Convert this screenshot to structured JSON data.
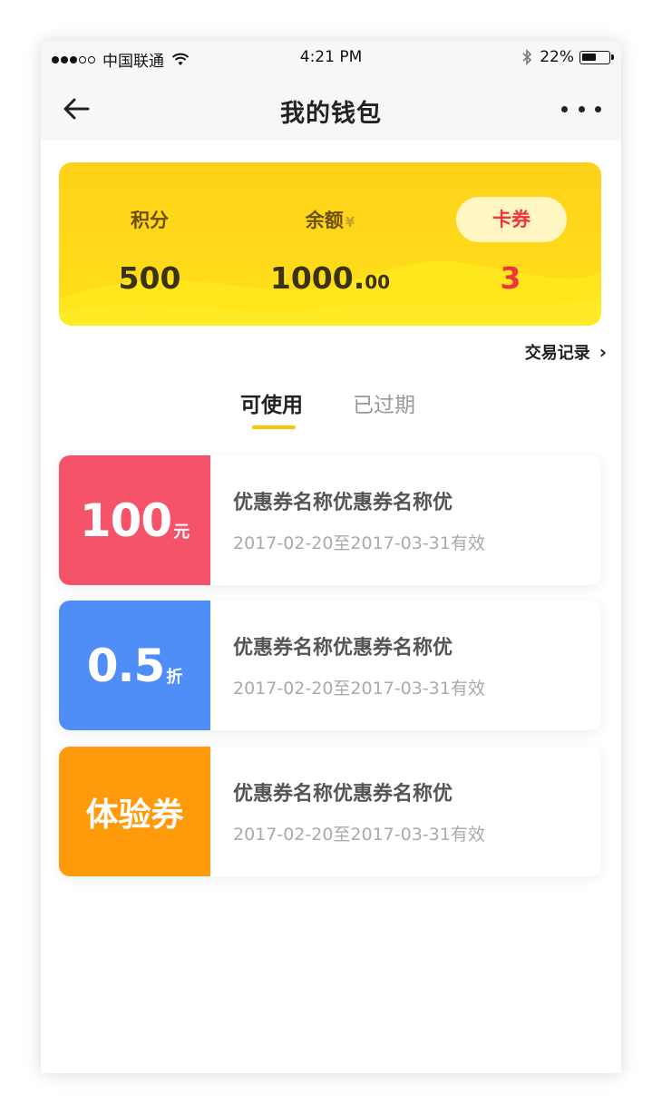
{
  "status_bar": {
    "carrier": "中国联通",
    "time": "4:21 PM",
    "battery_percent": "22%",
    "battery_level": 0.22,
    "icons": [
      "signal-dots-icon",
      "wifi-icon",
      "bluetooth-icon",
      "battery-icon"
    ]
  },
  "nav": {
    "title": "我的钱包",
    "back_icon": "arrow-left-icon",
    "more_icon": "more-dots-icon"
  },
  "wallet": {
    "points_label": "积分",
    "points_value": "500",
    "balance_label": "余额",
    "balance_currency": "¥",
    "balance_int": "1000.",
    "balance_dec": "00",
    "coupons_label": "卡券",
    "coupons_value": "3",
    "colors": {
      "card": "#ffd71a",
      "accent_red": "#f0343c"
    }
  },
  "transactions_link": "交易记录",
  "tabs": [
    {
      "label": "可使用",
      "active": true
    },
    {
      "label": "已过期",
      "active": false
    }
  ],
  "coupons": [
    {
      "amount": "100",
      "unit": "元",
      "name": "优惠券名称优惠券名称优",
      "validity": "2017-02-20至2017-03-31有效",
      "color": "#f4536a"
    },
    {
      "amount": "0.5",
      "unit": "折",
      "name": "优惠券名称优惠券名称优",
      "validity": "2017-02-20至2017-03-31有效",
      "color": "#4f8ef7"
    },
    {
      "text": "体验券",
      "name": "优惠券名称优惠券名称优",
      "validity": "2017-02-20至2017-03-31有效",
      "color": "#ff9a0a"
    }
  ]
}
